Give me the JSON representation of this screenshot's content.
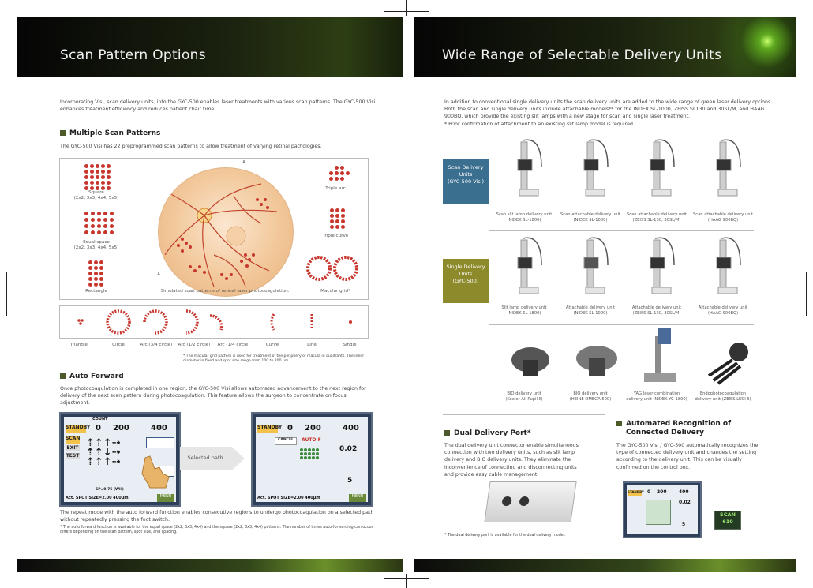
{
  "left_header": {
    "title": "Scan Pattern Options"
  },
  "right_header": {
    "title": "Wide Range of Selectable Delivery Units"
  },
  "left": {
    "intro": "Incorporating Visi, scan delivery units, into the GYC-500 enables laser treatments with various scan patterns. The GYC-500 Visi enhances treatment efficiency and reduces patient chair time.",
    "multiple_heading": "Multiple Scan Patterns",
    "multiple_text": "The GYC-500 Visi has 22 preprogrammed scan patterns to allow treatment of varying retinal pathologies.",
    "patterns": {
      "square": "Square\n(2x2, 3x3, 4x4, 5x5)",
      "equal_space": "Equal space\n(2x2, 3x3, 4x4, 5x5)",
      "rectangle": "Rectangle",
      "triple_arc": "Triple arc",
      "triple_curve": "Triple curve",
      "macular_grid": "Macular grid*",
      "sim_caption": "Simulated scan patterns of retinal laser photocoagulation.",
      "label_a_top": "A",
      "label_a_bottom": "A"
    },
    "row_patterns": [
      "Triangle",
      "Circle",
      "Arc (3/4 circle)",
      "Arc (1/2 circle)",
      "Arc (1/4 circle)",
      "Curve",
      "Line",
      "Single"
    ],
    "footnote1": "* The macular grid pattern is used for treatment of the periphery of macula in quadrants. The inner diameter in fixed and spot size range from 100 to 200 µm.",
    "auto_heading": "Auto Forward",
    "auto_text": "Once photocoagulation is completed in one region, the GYC-500 Visi allows automated advancement to the next region for delivery of the next scan pattern during photocoagulation. This feature allows the surgeon to concentrate on focus adjustment.",
    "selected_path": "Selected path",
    "repeat_text": "The repeat mode with the auto forward function enables consecutive regions to undergo photocoagulation on a selected path without repeatedly pressing the foot switch.",
    "footnote2": "* The auto forward function is available for the equal space (2x2, 3x3, 4x4) and the square (2x2, 3x3, 4x4) patterns. The number of times auto-forwarding can occur differs depending on the scan pattern, spot size, and spacing."
  },
  "screen": {
    "standby": "STANDBY",
    "count_label": "COUNT",
    "count_value": "0",
    "power_value": "200",
    "power2_value": "400",
    "scan_label": "SCAN",
    "exit_label": "EXIT",
    "test_label": "TEST",
    "spot_line": "Act. SPOT SIZE=2.00   400µm",
    "duration_value": "0.02",
    "interval_value": "5",
    "cancel_label": "CANCEL",
    "auto_label": "AUTO F",
    "menu_label": "MENU",
    "status_line": "SP=0.75 (WH)"
  },
  "right": {
    "intro": "In addition to conventional single delivery units the scan delivery units are added to the wide range of green laser delivery options. Both the scan and single delivery units include attachable models** for the INDEX SL-1000, ZEISS SL130 and 30SL/M, and HAAG 900BQ, which provide the existing slit lamps with a new stage for scan and single laser treatment.",
    "intro_note": "* Prior confirmation of attachment to an existing slit lamp model is required.",
    "scan_tag": "Scan Delivery\nUnits\n(GYC-500 Visi)",
    "single_tag": "Single Delivery\nUnits\n(GYC-500)",
    "scan_units": [
      "Scan slit lamp delivery unit\n(NIDEK SL-1800)",
      "Scan attachable delivery unit\n(NIDEK SL-1000)",
      "Scan attachable delivery unit\n(ZEISS SL-130, 30SL/M)",
      "Scan attachable delivery unit\n(HAAG 900BQ)"
    ],
    "single_units": [
      "Slit lamp delivery unit\n(NIDEK SL-1800)",
      "Attachable delivery unit\n(NIDEK SL-1000)",
      "Attachable delivery unit\n(ZEISS SL-130, 30SL/M)",
      "Attachable delivery unit\n(HAAG 900BQ)"
    ],
    "other_units": [
      "BIO delivery unit\n(Keeler All Pupil II)",
      "BIO delivery unit\n(HEINE OMEGA 500)",
      "YAG laser combination\ndelivery unit (NIDEK YC-1800)",
      "Endophotocoagulation\ndelivery unit (ZEISS LUCI II)"
    ],
    "dual_heading": "Dual Delivery Port*",
    "dual_text": "The dual delivery unit connector enable simultaneous connection with two delivery units, such as slit lamp delivery and BIO delivery units. They eliminate the inconvenience of connecting and disconnecting units and provide easy cable management.",
    "dual_note": "* The dual delivery port is available for the dual delivery model.",
    "auto_heading_1": "Automated Recognition of",
    "auto_heading_2": "Connected Delivery",
    "auto_text": "The GYC-500 Visi / GYC-500 automatically recognizes the type of connected delivery unit and changes the setting according to the delivery unit. This can be visually confirmed on the control box.",
    "scan_badge_1": "SCAN",
    "scan_badge_2": "610"
  },
  "colors": {
    "scan_tag": "#3b6f8f",
    "single_tag": "#8c8a2a",
    "header_dark": "#0b0f08",
    "accent_green": "#8ed13a",
    "dot_red": "#c8372e"
  }
}
